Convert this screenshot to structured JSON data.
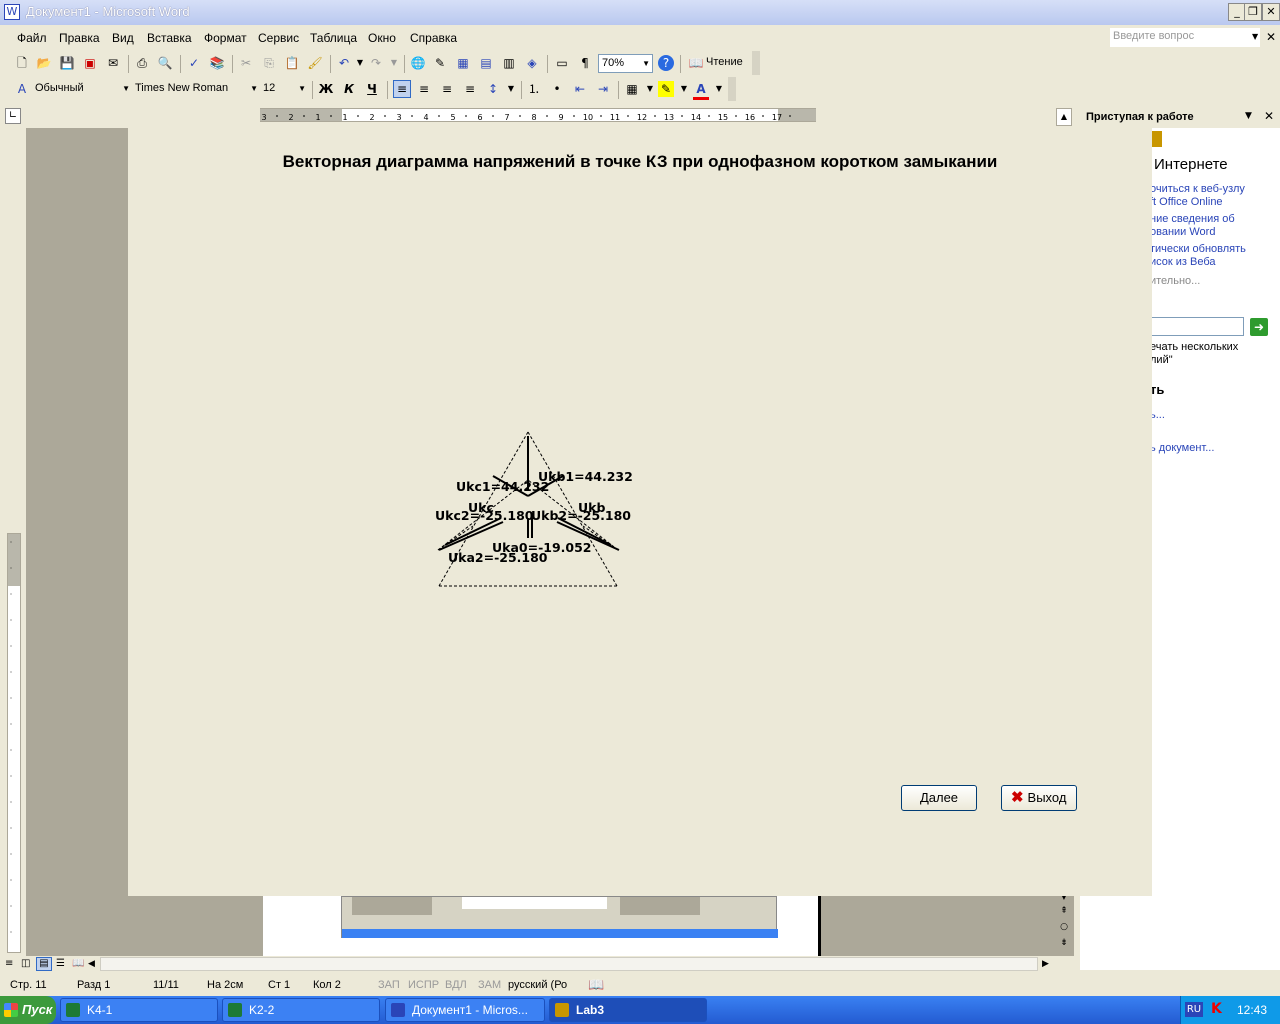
{
  "window": {
    "title": "Документ1 - Microsoft Word"
  },
  "menu": [
    "Файл",
    "Правка",
    "Вид",
    "Вставка",
    "Формат",
    "Сервис",
    "Таблица",
    "Окно",
    "Справка"
  ],
  "question_box": {
    "placeholder": "Введите вопрос"
  },
  "toolbar": {
    "zoom": "70%",
    "reading_label": "Чтение"
  },
  "format_toolbar": {
    "style": "Обычный",
    "font": "Times New Roman",
    "size": "12",
    "bold": "Ж",
    "italic": "К",
    "underline": "Ч"
  },
  "ruler": {
    "ticks": [
      "3",
      "2",
      "1",
      "1",
      "2",
      "3",
      "4",
      "5",
      "6",
      "7",
      "8",
      "9",
      "10",
      "11",
      "12",
      "13",
      "14",
      "15",
      "16",
      "17"
    ]
  },
  "dialog": {
    "title": "Векторная диаграмма напряжений в точке КЗ при однофазном коротком замыкании",
    "next_button": "Далее",
    "exit_button": "Выход"
  },
  "diagram": {
    "labels": {
      "ukb1": "Ukb1=44.232",
      "ukc1": "Ukc1=44.232",
      "ukc": "Ukc",
      "ukb": "Ukb",
      "ukc2": "Ukc2=-25.180",
      "ukb2": "Ukb2=-25.180",
      "uka0": "Uka0=-19.052",
      "uka2": "Uka2=-25.180"
    }
  },
  "taskpane": {
    "title": "Приступая к работе",
    "section1": "Интернете",
    "links": [
      "очиться к веб-узлу",
      "ft Office Online",
      "ние сведения об",
      "овании Word",
      "тически обновлять",
      "исок из Веба",
      "ительно..."
    ],
    "search_hint_1": "ечать нескольких",
    "search_hint_2": "лий\"",
    "section2": "ть",
    "open_link_1": "ь...",
    "open_link_2": "ь документ..."
  },
  "status": {
    "page": "Стр. 11",
    "section": "Разд 1",
    "pages": "11/11",
    "at": "На 2см",
    "line": "Ст 1",
    "col": "Кол 2",
    "rec": "ЗАП",
    "trk": "ИСПР",
    "ext": "ВДЛ",
    "ovr": "ЗАМ",
    "lang": "русский (Ро"
  },
  "taskbar": {
    "start": "Пуск",
    "tasks": [
      "K4-1",
      "K2-2",
      "Документ1 - Micros...",
      "Lab3"
    ],
    "lang": "RU",
    "time": "12:43"
  },
  "colors": {
    "taskbar": "#235bd1",
    "dialog_bg": "#ece9d8",
    "gray_area": "#aca899",
    "link": "#2a45b8"
  }
}
